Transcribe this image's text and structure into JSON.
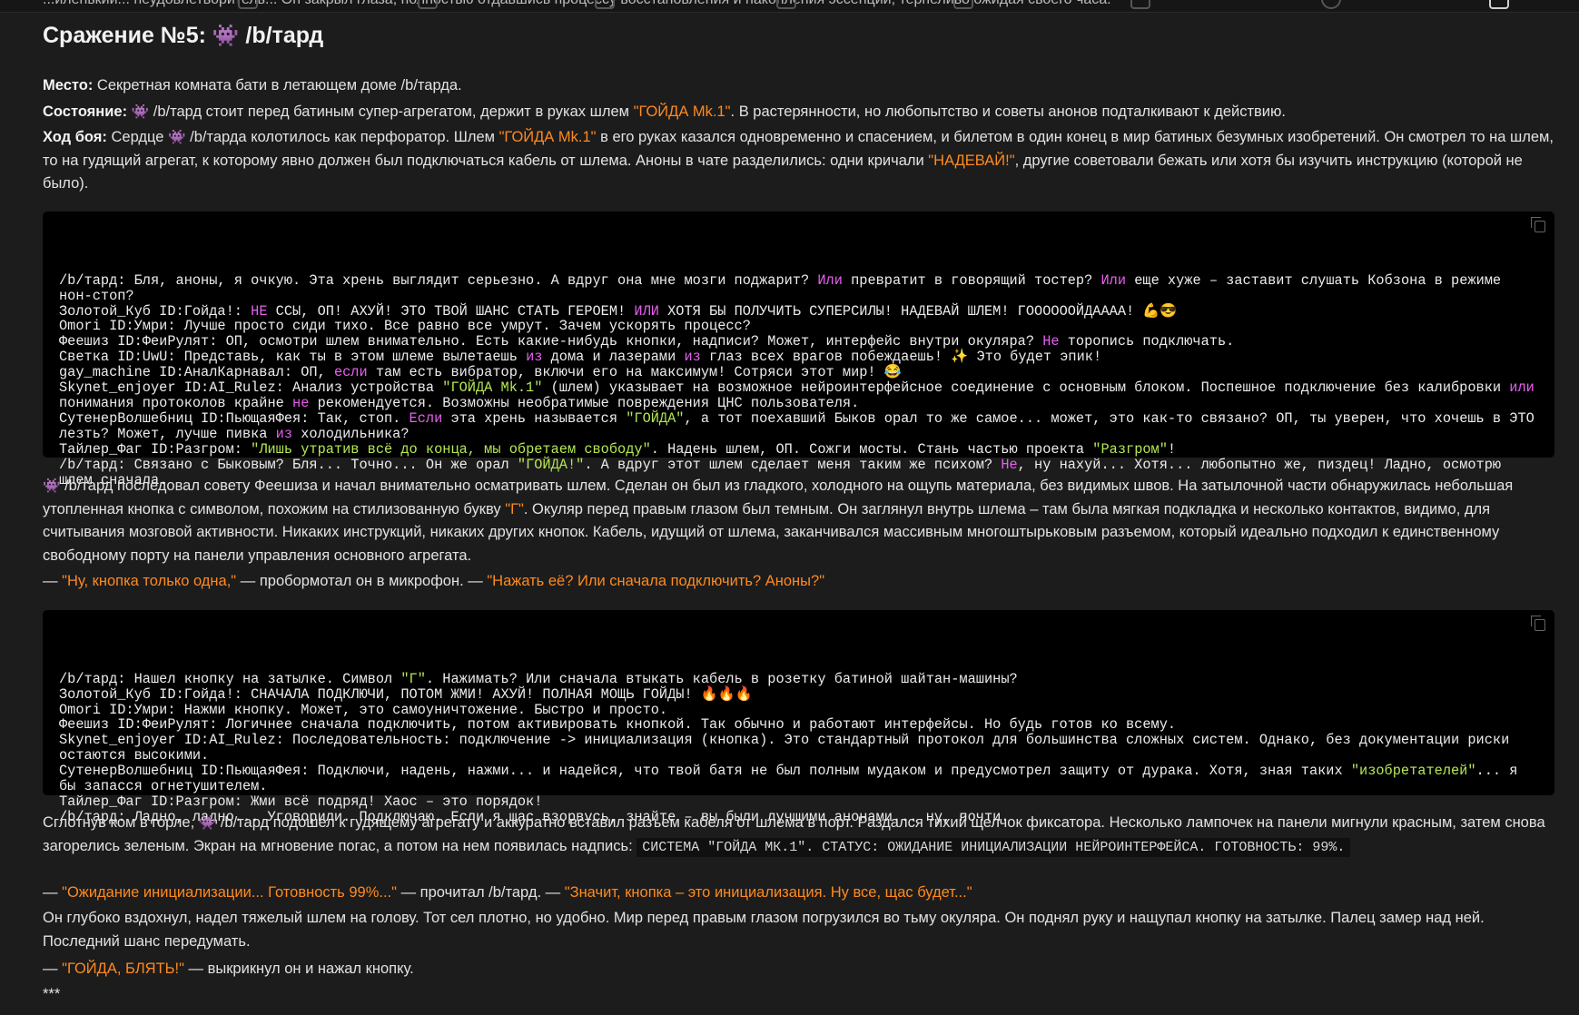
{
  "topbar": {
    "cut_text": "...иленький... неудовлетворитель... Он закрыл глаза, полностью отдавшись процессу восстановления и накопления эссенции, терпеливо ожидая своего часа."
  },
  "battle": {
    "title_prefix": "Сражение №5: ",
    "title_suffix": " /b/тард",
    "emoji": "👾"
  },
  "intro": {
    "place_label": "Место:",
    "place_text": " Секретная комната бати в летающем доме /b/тарда.",
    "state_label": "Состояние:",
    "state_text_1": " /b/тард стоит перед батиным супер-агрегатом, держит в руках шлем ",
    "state_helmet": "\"ГОЙДА Mk.1\"",
    "state_text_2": ". В растерянности, но любопытство и советы анонов подталкивают к действию.",
    "fight_label": "Ход боя:",
    "fight_text_1": " Сердце ",
    "fight_text_2": " /b/тарда колотилось как перфоратор. Шлем ",
    "fight_helmet": "\"ГОЙДА Mk.1\"",
    "fight_text_3": " в его руках казался одновременно и спасением, и билетом в один конец в мир батиных безумных изобретений. Он смотрел то на шлем, то на гудящий агрегат, к которому явно должен был подключаться кабель от шлема. Аноны в чате разделились: одни кричали ",
    "fight_shout": "\"НАДЕВАЙ!\"",
    "fight_text_4": ", другие советовали бежать или хотя бы изучить инструкцию (которой не было)."
  },
  "chat1": [
    [
      [
        "t",
        "/b/тард: Бля, аноны, я очкую. Эта хрень выглядит серьезно. А вдруг она мне мозги поджарит? "
      ],
      [
        "k",
        "Или"
      ],
      [
        "t",
        " превратит в говорящий тостер? "
      ],
      [
        "k",
        "Или"
      ],
      [
        "t",
        " еще хуже – заставит слушать Кобзона в режиме нон-стоп?"
      ]
    ],
    [
      [
        "t",
        "Золотой_Куб ID:Гойда!: "
      ],
      [
        "k",
        "НЕ"
      ],
      [
        "t",
        " ССЫ, ОП! АХУЙ! ЭТО ТВОЙ ШАНС СТАТЬ ГЕРОЕМ! "
      ],
      [
        "k",
        "ИЛИ"
      ],
      [
        "t",
        " ХОТЯ БЫ ПОЛУЧИТЬ СУПЕРСИЛЫ! НАДЕВАЙ ШЛЕМ! ГООООООЙДАААА! 💪😎"
      ]
    ],
    [
      [
        "t",
        "Omori ID:Умри: Лучше просто сиди тихо. Все равно все умрут. Зачем ускорять процесс?"
      ]
    ],
    [
      [
        "t",
        "Феешиз ID:ФеиРулят: ОП, осмотри шлем внимательно. Есть какие-нибудь кнопки, надписи? Может, интерфейс внутри окуляра? "
      ],
      [
        "k",
        "Не"
      ],
      [
        "t",
        " торопись подключать."
      ]
    ],
    [
      [
        "t",
        "Светка ID:UwU: Представь, как ты в этом шлеме вылетаешь "
      ],
      [
        "k",
        "из"
      ],
      [
        "t",
        " дома и лазерами "
      ],
      [
        "k",
        "из"
      ],
      [
        "t",
        " глаз всех врагов побеждаешь! ✨ Это будет эпик!"
      ]
    ],
    [
      [
        "t",
        "gay_machine ID:АналКарнавал: ОП, "
      ],
      [
        "k",
        "если"
      ],
      [
        "t",
        " там есть вибратор, включи его на максимум! Сотряси этот мир! 😂"
      ]
    ],
    [
      [
        "t",
        "Skynet_enjoyer ID:AI_Rulez: Анализ устройства "
      ],
      [
        "s",
        "\"ГОЙДА Mk.1\""
      ],
      [
        "t",
        " (шлем) указывает на возможное нейроинтерфейсное соединение с основным блоком. Поспешное подключение без калибровки "
      ],
      [
        "k",
        "или"
      ],
      [
        "t",
        " понимания протоколов крайне "
      ],
      [
        "k",
        "не"
      ],
      [
        "t",
        " рекомендуется. Возможны необратимые повреждения ЦНС пользователя."
      ]
    ],
    [
      [
        "t",
        "СутенерВолшебниц ID:ПьющаяФея: Так, стоп. "
      ],
      [
        "k",
        "Если"
      ],
      [
        "t",
        " эта хрень называется "
      ],
      [
        "s",
        "\"ГОЙДА\""
      ],
      [
        "t",
        ", а тот поехавший Быков орал то же самое... может, это как-то связано? ОП, ты уверен, что хочешь в ЭТО лезть? Может, лучше пивка "
      ],
      [
        "k",
        "из"
      ],
      [
        "t",
        " холодильника?"
      ]
    ],
    [
      [
        "t",
        "Тайлер_Фаг ID:Разгром: "
      ],
      [
        "s",
        "\"Лишь утратив всё до конца, мы обретаем свободу\""
      ],
      [
        "t",
        ". Надень шлем, ОП. Сожги мосты. Стань частью проекта "
      ],
      [
        "s",
        "\"Разгром\""
      ],
      [
        "t",
        "!"
      ]
    ],
    [
      [
        "t",
        "/b/тард: Связано с Быковым? Бля... Точно... Он же орал "
      ],
      [
        "s",
        "\"ГОЙДА!\""
      ],
      [
        "t",
        ". А вдруг этот шлем сделает меня таким же психом? "
      ],
      [
        "k",
        "Не"
      ],
      [
        "t",
        ", ну нахуй... Хотя... любопытно же, пиздец! Ладно, осмотрю шлем сначала."
      ]
    ]
  ],
  "middle": {
    "p1_text_1": " /b/тард последовал совету Феешиза и начал внимательно осматривать шлем. Сделан он был из гладкого, холодного на ощупь материала, без видимых швов. На затылочной части обнаружилась небольшая утопленная кнопка с символом, похожим на стилизованную букву ",
    "p1_letter": "\"Г\"",
    "p1_text_2": ". Окуляр перед правым глазом был темным. Он заглянул внутрь шлема – там была мягкая подкладка и несколько контактов, видимо, для считывания мозговой активности. Никаких инструкций, никаких других кнопок. Кабель, идущий от шлема, заканчивался массивным многоштырьковым разъемом, который идеально подходил к единственному свободному порту на панели управления основного агрегата.",
    "p2_dash_1": "— ",
    "p2_quote_1": "\"Ну, кнопка только одна,\"",
    "p2_text": " — пробормотал он в микрофон. — ",
    "p2_quote_2": "\"Нажать её? Или сначала подключить? Аноны?\""
  },
  "chat2": [
    [
      [
        "t",
        "/b/тард: Нашел кнопку на затылке. Символ "
      ],
      [
        "s",
        "\"Г\""
      ],
      [
        "t",
        ". Нажимать? Или сначала втыкать кабель в розетку батиной шайтан-машины?"
      ]
    ],
    [
      [
        "t",
        "Золотой_Куб ID:Гойда!: СНАЧАЛА ПОДКЛЮЧИ, ПОТОМ ЖМИ! АХУЙ! ПОЛНАЯ МОЩЬ ГОЙДЫ! 🔥🔥🔥"
      ]
    ],
    [
      [
        "t",
        "Omori ID:Умри: Нажми кнопку. Может, это самоуничтожение. Быстро и просто."
      ]
    ],
    [
      [
        "t",
        "Феешиз ID:ФеиРулят: Логичнее сначала подключить, потом активировать кнопкой. Так обычно и работают интерфейсы. Но будь готов ко всему."
      ]
    ],
    [
      [
        "t",
        "Skynet_enjoyer ID:AI_Rulez: Последовательность: подключение -> инициализация (кнопка). Это стандартный протокол для большинства сложных систем. Однако, без документации риски остаются высокими."
      ]
    ],
    [
      [
        "t",
        "СутенерВолшебниц ID:ПьющаяФея: Подключи, надень, нажми... и надейся, что твой батя не был полным мудаком и предусмотрел защиту от дурака. Хотя, зная таких "
      ],
      [
        "s",
        "\"изобретателей\""
      ],
      [
        "t",
        "... я бы запасся огнетушителем."
      ]
    ],
    [
      [
        "t",
        "Тайлер_Фаг ID:Разгром: Жми всё подряд! Хаос – это порядок!"
      ]
    ],
    [
      [
        "t",
        "/b/тард: Ладно, ладно... Уговорили. Подключаю. Если я щас взорвусь, знайте – вы были лучшими анонами... ну, почти."
      ]
    ]
  ],
  "ending": {
    "p1_text_1": "Сглотнув ком в горле, ",
    "p1_text_2": " /b/тард подошел к гудящему агрегату и аккуратно вставил разъем кабеля от шлема в порт. Раздался тихий щелчок фиксатора. Несколько лампочек на панели мигнули красным, затем снова загорелись зеленым. Экран на мгновение погас, а потом на нем появилась надпись: ",
    "p1_code": "СИСТЕМА \"ГОЙДА МК.1\". СТАТУС: ОЖИДАНИЕ ИНИЦИАЛИЗАЦИИ НЕЙРОИНТЕРФЕЙСА. ГОТОВНОСТЬ: 99%.",
    "p2_dash": "— ",
    "p2_quote_1": "\"Ожидание инициализации... Готовность 99%...\"",
    "p2_text": " — прочитал /b/тард. — ",
    "p2_quote_2": "\"Значит, кнопка – это инициализация. Ну все, щас будет...\"",
    "p3": "Он глубоко вздохнул, надел тяжелый шлем на голову. Тот сел плотно, но удобно. Мир перед правым глазом погрузился во тьму окуляра. Он поднял руку и нащупал кнопку на затылке. Палец замер над ней. Последний шанс передумать.",
    "p4_dash": "— ",
    "p4_quote": "\"ГОЙДА, БЛЯТЬ!\"",
    "p4_text": " — выкрикнул он и нажал кнопку.",
    "p5": "***"
  },
  "icons": {
    "copy": "copy-icon",
    "emoji": "alien-monster-emoji"
  },
  "colors": {
    "background": "#1c1c1c",
    "code_background": "#000000",
    "quote_orange": "#ff8a1f",
    "code_keyword": "#e85ef0",
    "code_string": "#b5e853"
  }
}
